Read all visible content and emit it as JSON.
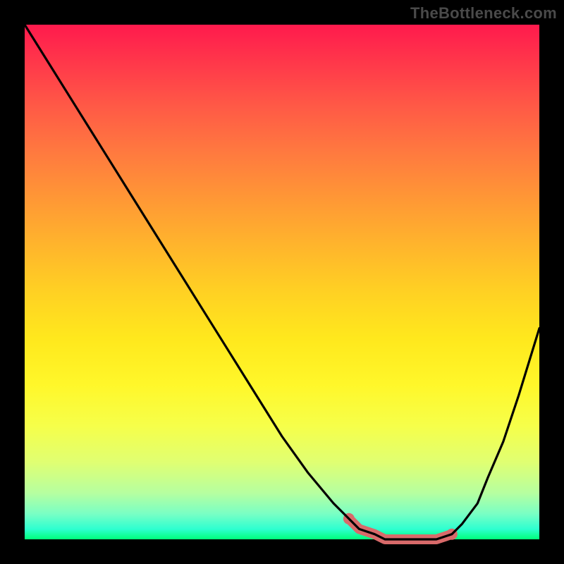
{
  "watermark": "TheBottleneck.com",
  "colors": {
    "black_curve": "#000000",
    "highlight": "#d86a6a",
    "bg_black": "#000000"
  },
  "chart_data": {
    "type": "line",
    "title": "",
    "xlabel": "",
    "ylabel": "",
    "xlim": [
      0,
      100
    ],
    "ylim": [
      0,
      100
    ],
    "grid": false,
    "legend": false,
    "background": "red-yellow-green vertical gradient",
    "series": [
      {
        "name": "bottleneck-curve",
        "x": [
          0,
          5,
          10,
          15,
          20,
          25,
          30,
          35,
          40,
          45,
          50,
          55,
          60,
          63,
          65,
          68,
          70,
          73,
          76,
          80,
          83,
          85,
          88,
          90,
          93,
          96,
          100
        ],
        "y": [
          100,
          92,
          84,
          76,
          68,
          60,
          52,
          44,
          36,
          28,
          20,
          13,
          7,
          4,
          2,
          1,
          0,
          0,
          0,
          0,
          1,
          3,
          7,
          12,
          19,
          28,
          41
        ]
      },
      {
        "name": "optimal-range-highlight",
        "x": [
          63,
          65,
          68,
          70,
          73,
          76,
          80,
          83
        ],
        "y": [
          4,
          2,
          1,
          0,
          0,
          0,
          0,
          1
        ]
      }
    ],
    "annotations": [
      {
        "type": "point",
        "x": 63,
        "y": 4,
        "style": "highlight-dot"
      },
      {
        "type": "point",
        "x": 83,
        "y": 1,
        "style": "highlight-dot"
      }
    ]
  }
}
